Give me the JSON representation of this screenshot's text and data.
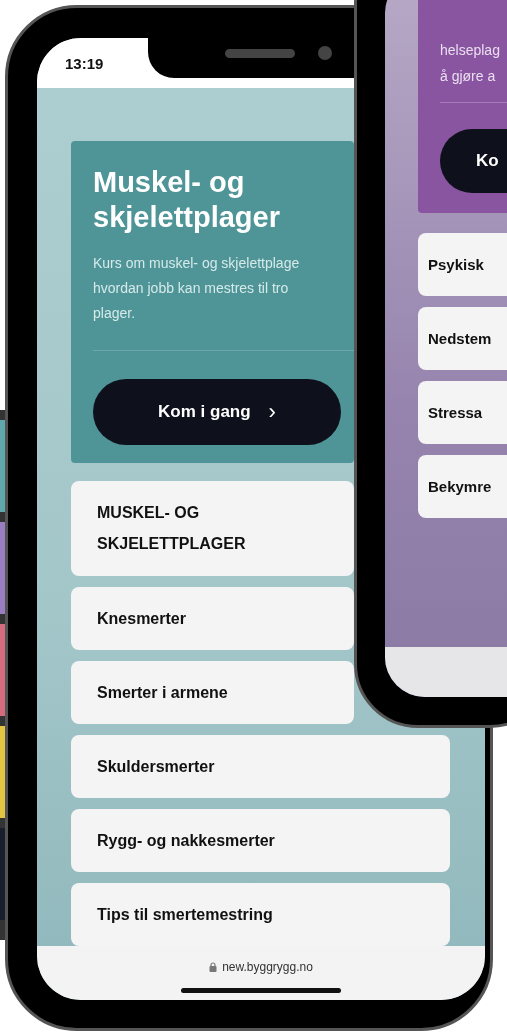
{
  "front_phone": {
    "status_bar": {
      "time": "13:19"
    },
    "hero": {
      "title": "Muskel- og skjelettplager",
      "description_lines": [
        "Kurs om muskel- og skjelettplage",
        "hvordan jobb kan mestres til tro",
        "plager."
      ],
      "button": "Kom i gang",
      "button_icon": "›"
    },
    "topics": [
      {
        "label": "MUSKEL- OG SKJELETTPLAGER"
      },
      {
        "label": "Knesmerter"
      },
      {
        "label": "Smerter i armene"
      },
      {
        "label": "Skuldersmerter"
      },
      {
        "label": "Rygg- og nakkesmerter"
      },
      {
        "label": "Tips til smertemestring"
      }
    ],
    "address_bar": {
      "url": "new.byggrygg.no"
    }
  },
  "back_phone": {
    "hero": {
      "description_lines": [
        "helseplag",
        "å gjøre a"
      ],
      "button": "Ko"
    },
    "topics": [
      {
        "label": "Psykisk"
      },
      {
        "label": "Nedstem"
      },
      {
        "label": "Stressa"
      },
      {
        "label": "Bekymre"
      }
    ]
  }
}
